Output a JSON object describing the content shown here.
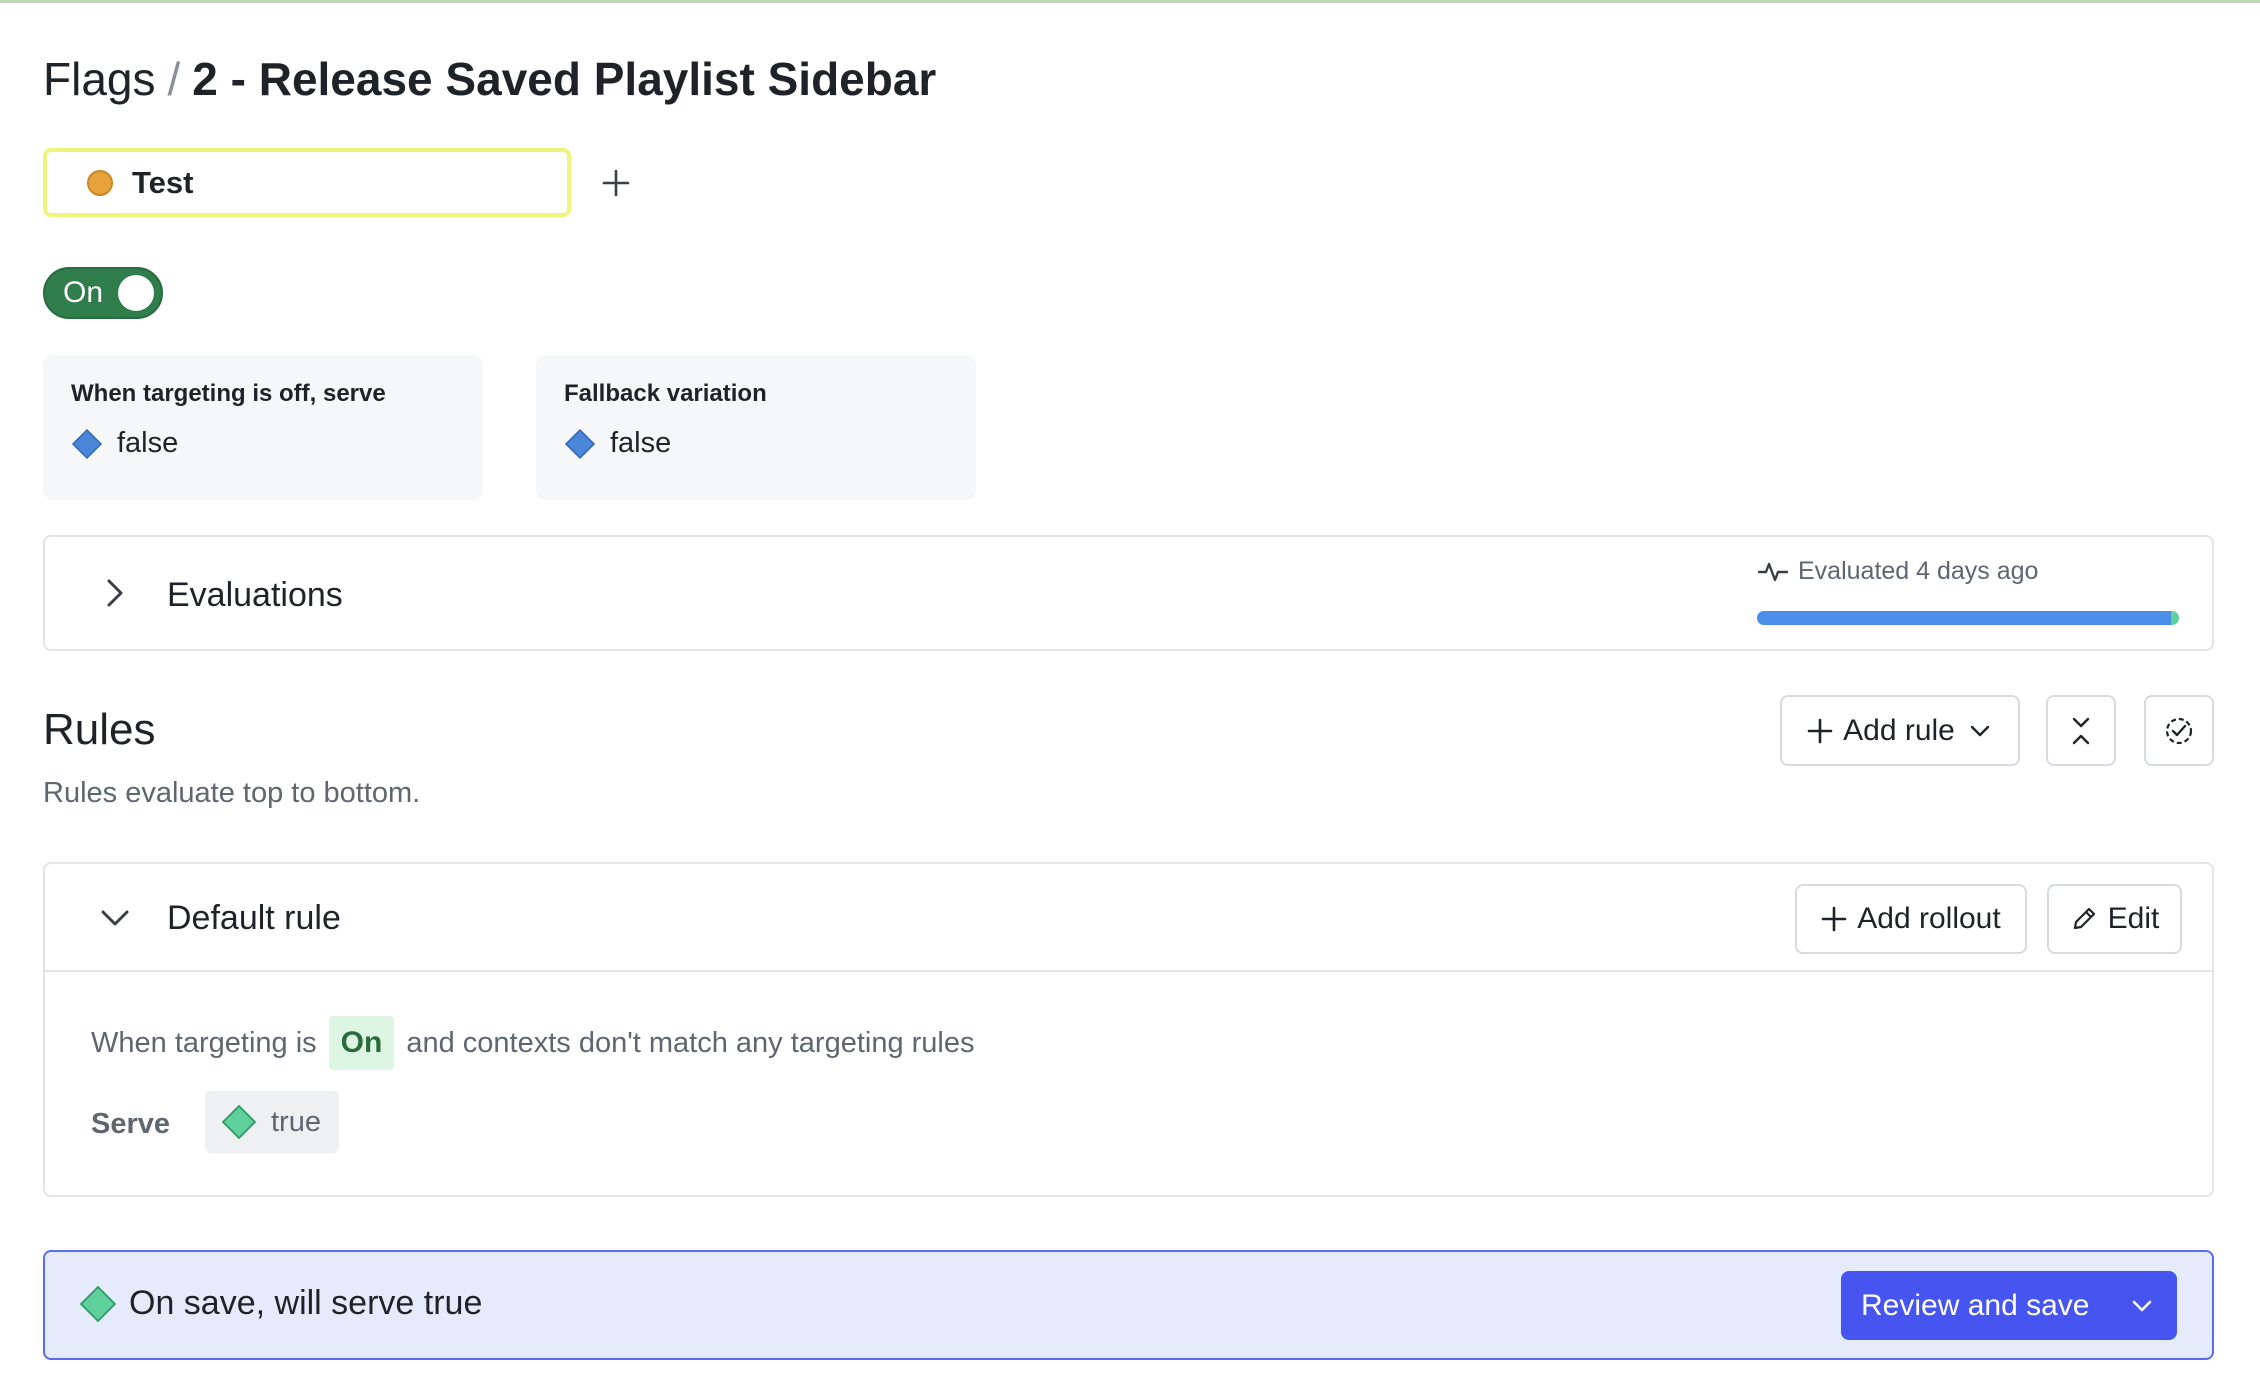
{
  "breadcrumb": {
    "parent": "Flags",
    "separator": "/",
    "current": "2 - Release Saved Playlist Sidebar"
  },
  "environment": {
    "name": "Test",
    "dot_color": "#e8a23b",
    "add_icon": "plus-icon"
  },
  "toggle": {
    "label": "On",
    "state": "on",
    "color": "#2e7d4a"
  },
  "off_variation": {
    "title": "When targeting is off, serve",
    "value": "false",
    "icon": "diamond-icon",
    "icon_color": "#4a86d8"
  },
  "fallback_variation": {
    "title": "Fallback variation",
    "value": "false",
    "icon": "diamond-icon",
    "icon_color": "#4a86d8"
  },
  "evaluations": {
    "title": "Evaluations",
    "status": "Evaluated 4 days ago",
    "status_icon": "pulse-icon",
    "bar": {
      "primary_fraction": 0.98,
      "secondary_fraction": 0.02,
      "primary_color": "#4b8ee8",
      "secondary_color": "#5dd39a"
    }
  },
  "rules": {
    "title": "Rules",
    "subtitle": "Rules evaluate top to bottom.",
    "add_rule_label": "Add rule",
    "collapse_icon": "collapse-icon",
    "check_icon": "check-circle-icon"
  },
  "default_rule": {
    "title": "Default rule",
    "add_rollout_label": "Add rollout",
    "edit_label": "Edit",
    "description_prefix": "When targeting is",
    "state_chip": "On",
    "description_suffix": "and contexts don't match any targeting rules",
    "serve_label": "Serve",
    "serve_value": "true",
    "serve_icon_color": "#5fcf9b"
  },
  "save_bar": {
    "message": "On save, will serve true",
    "icon_color": "#5fcf9b",
    "button_label": "Review and save",
    "accent": "#4655f0"
  }
}
